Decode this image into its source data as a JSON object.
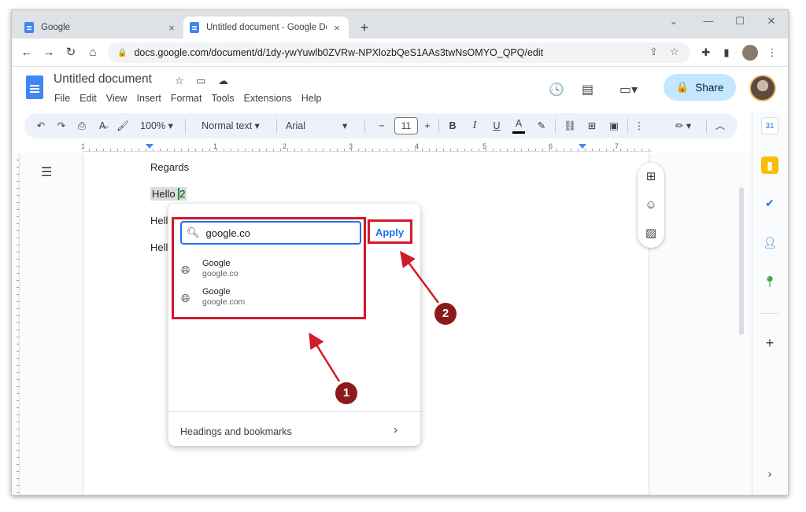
{
  "browser": {
    "tabs": [
      {
        "title": "Google",
        "close": "×"
      },
      {
        "title": "Untitled document - Google Docs",
        "close": "×"
      }
    ],
    "new_tab": "+",
    "window_controls": {
      "minimize": "—",
      "maximize": "☐",
      "close": "✕",
      "chevron": "⌄"
    },
    "nav": {
      "back": "←",
      "forward": "→",
      "reload": "↻",
      "home": "⌂"
    },
    "url": "docs.google.com/document/d/1dy-ywYuwlb0ZVRw-NPXlozbQeS1AAs3twNsOMYO_QPQ/edit"
  },
  "docs": {
    "title": "Untitled document",
    "menu": [
      "File",
      "Edit",
      "View",
      "Insert",
      "Format",
      "Tools",
      "Extensions",
      "Help"
    ],
    "share_label": "Share"
  },
  "toolbar": {
    "zoom": "100%",
    "style": "Normal text",
    "font": "Arial",
    "font_size": "11",
    "bold": "B",
    "italic": "I",
    "underline": "U",
    "text_color": "A"
  },
  "ruler": {
    "numbers": [
      "1",
      "1",
      "2",
      "3",
      "4",
      "5",
      "6",
      "7"
    ]
  },
  "document": {
    "lines": [
      "Regards",
      "Hello",
      "2",
      "Hell",
      "Hell"
    ]
  },
  "link_popup": {
    "search_value": "google.co",
    "apply_label": "Apply",
    "suggestions": [
      {
        "title": "Google",
        "url": "google.co"
      },
      {
        "title": "Google",
        "url": "google.com"
      }
    ],
    "headings_label": "Headings and bookmarks"
  },
  "annotations": {
    "one": "1",
    "two": "2"
  },
  "colors": {
    "accent": "#1a73e8",
    "annotation_red": "#d11a2a",
    "share_bg": "#c2e7ff"
  }
}
